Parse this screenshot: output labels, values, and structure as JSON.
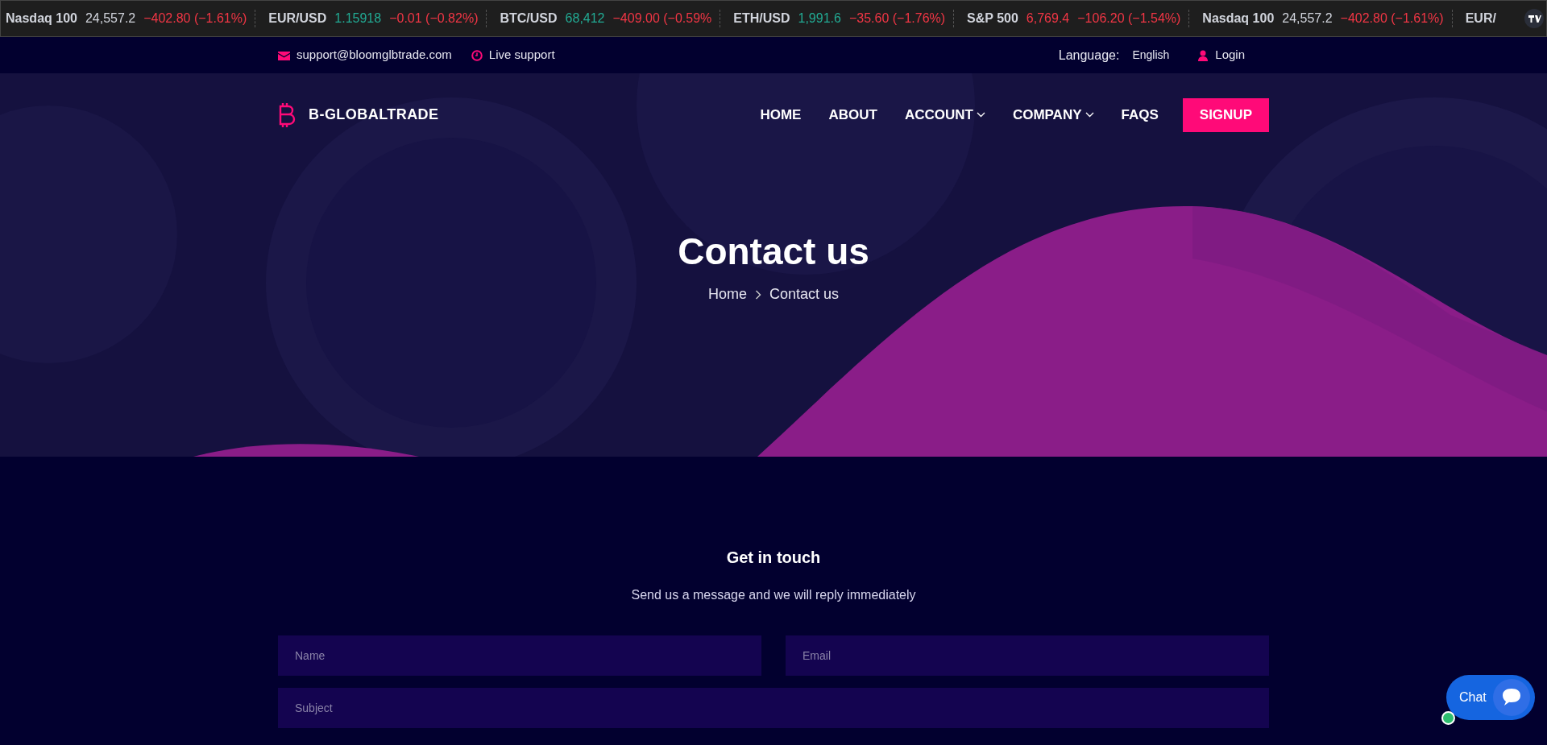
{
  "ticker": [
    {
      "symbol": "Nasdaq 100",
      "price": "24,557.2",
      "color": "#d1d4dc",
      "change": "−402.80 (−1.61%)"
    },
    {
      "symbol": "EUR/USD",
      "price": "1.15918",
      "color": "#22ab94",
      "change": "−0.01 (−0.82%)"
    },
    {
      "symbol": "BTC/USD",
      "price": "68,412",
      "color": "#22ab94",
      "change": "−409.00 (−0.59%"
    },
    {
      "symbol": "ETH/USD",
      "price": "1,991.6",
      "color": "#22ab94",
      "change": "−35.60 (−1.76%)"
    },
    {
      "symbol": "S&P 500",
      "price": "6,769.4",
      "color": "#f23645",
      "change": "−106.20 (−1.54%)"
    },
    {
      "symbol": "Nasdaq 100",
      "price": "24,557.2",
      "color": "#d1d4dc",
      "change": "−402.80 (−1.61%)"
    },
    {
      "symbol": "EUR/"
    }
  ],
  "top_bar": {
    "email": "support@bloomglbtrade.com",
    "live_support": "Live support",
    "language_label": "Language:",
    "language": "English",
    "login": "Login"
  },
  "nav": {
    "logo": "B-GLOBALTRADE",
    "items": [
      {
        "label": "HOME",
        "dropdown": false
      },
      {
        "label": "ABOUT",
        "dropdown": false
      },
      {
        "label": "ACCOUNT",
        "dropdown": true
      },
      {
        "label": "COMPANY",
        "dropdown": true
      },
      {
        "label": "FAQS",
        "dropdown": false
      }
    ],
    "signup": "SIGNUP"
  },
  "hero": {
    "title": "Contact us",
    "breadcrumb": [
      "Home",
      "Contact us"
    ]
  },
  "contact": {
    "heading": "Get in touch",
    "subtitle": "Send us a message and we will reply immediately",
    "fields": [
      {
        "placeholder": "Name"
      },
      {
        "placeholder": "Email"
      },
      {
        "placeholder": "Subject"
      }
    ]
  },
  "chat": {
    "label": "Chat",
    "online": true
  }
}
